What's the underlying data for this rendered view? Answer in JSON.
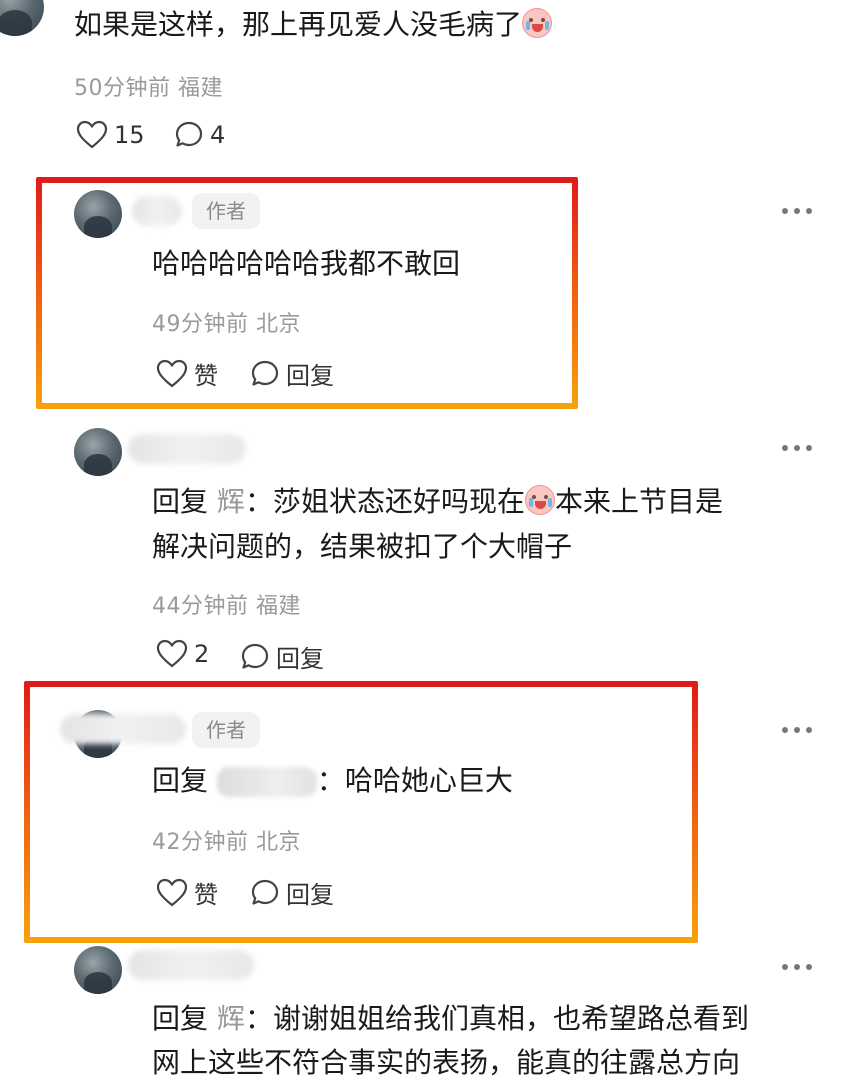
{
  "comments": [
    {
      "text": "如果是这样，那上再见爱人没毛病了",
      "meta": "50分钟前 福建",
      "likes": "15",
      "replies": "4"
    },
    {
      "author_badge": "作者",
      "text": "哈哈哈哈哈哈我都不敢回",
      "meta": "49分钟前 北京",
      "like_label": "赞",
      "reply_label": "回复"
    },
    {
      "reply_prefix": "回复",
      "mention": "辉",
      "line1_a": "：莎姐状态还好吗现在",
      "line1_b": "本来上节目是",
      "line2": "解决问题的，结果被扣了个大帽子",
      "meta": "44分钟前 福建",
      "likes": "2",
      "reply_label": "回复"
    },
    {
      "author_badge": "作者",
      "reply_prefix": "回复",
      "text": "：哈哈她心巨大",
      "meta": "42分钟前 北京",
      "like_label": "赞",
      "reply_label": "回复"
    },
    {
      "reply_prefix": "回复",
      "mention": "辉",
      "line1": "：谢谢姐姐给我们真相，也希望路总看到",
      "line2": "网上这些不符合事实的表扬，能真的往露总方向"
    }
  ],
  "icons": {
    "like": "heart-outline-icon",
    "reply": "speech-bubble-icon",
    "more": "more-dots-icon",
    "emoji": "crying-face-emoji"
  },
  "colors": {
    "highlight_top": "#e01a1a",
    "highlight_bottom": "#f7a20c",
    "meta_text": "#9a9a9a",
    "badge_bg": "#f2f2f2"
  }
}
